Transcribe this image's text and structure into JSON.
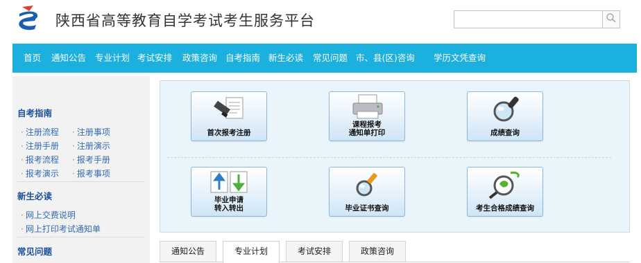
{
  "header": {
    "site_title": "陕西省高等教育自学考试考生服务平台",
    "search": {
      "value": "",
      "placeholder": ""
    },
    "logo_icon": "brand-logo-icon",
    "search_icon": "search-icon"
  },
  "nav": {
    "items": [
      "首页",
      "通知公告",
      "专业计划",
      "考试安排",
      "政策咨询",
      "自考指南",
      "新生必读",
      "常见问题",
      "市、县(区)咨询",
      "学历文凭查询"
    ]
  },
  "sidebar": {
    "sections": [
      {
        "title": "自考指南",
        "links": [
          "注册流程",
          "注册事项",
          "注册手册",
          "注册演示",
          "报考流程",
          "报考手册",
          "报考演示",
          "报考事项"
        ]
      },
      {
        "title": "新生必读",
        "links": [
          "网上交费说明",
          "网上打印考试通知单"
        ]
      },
      {
        "title": "常见问题",
        "links": []
      }
    ]
  },
  "tiles": [
    {
      "label": "首次报考注册",
      "icon": "document-register-icon"
    },
    {
      "label": "课程报考\n通知单打印",
      "icon": "printer-icon"
    },
    {
      "label": "成绩查询",
      "icon": "magnifier-icon"
    },
    {
      "label": "毕业申请\n转入转出",
      "icon": "transfer-arrows-icon"
    },
    {
      "label": "毕业证书查询",
      "icon": "certificate-search-icon"
    },
    {
      "label": "考生合格成绩查询",
      "icon": "qualified-score-search-icon"
    }
  ],
  "tabs": {
    "items": [
      "通知公告",
      "专业计划",
      "考试安排",
      "政策咨询"
    ],
    "active": "专业计划"
  },
  "colors": {
    "nav_bg": "#1bb0de",
    "sidebar_bg": "#f2f2f2",
    "heading_blue": "#1a4f9c",
    "link_blue": "#336cb3",
    "panel_bg": "#eaf4fb"
  }
}
